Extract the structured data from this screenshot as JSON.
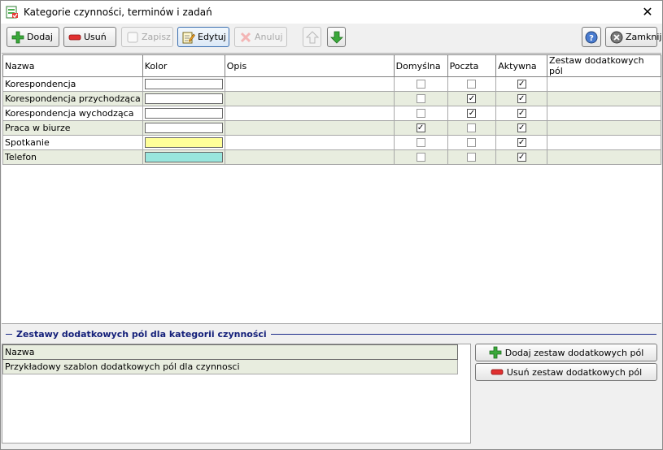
{
  "window": {
    "title": "Kategorie czynności, terminów i zadań"
  },
  "toolbar": {
    "add_label": "Dodaj",
    "remove_label": "Usuń",
    "save_label": "Zapisz",
    "edit_label": "Edytuj",
    "cancel_label": "Anuluj",
    "close_label": "Zamknij"
  },
  "grid": {
    "columns": [
      "Nazwa",
      "Kolor",
      "Opis",
      "Domyślna",
      "Poczta",
      "Aktywna",
      "Zestaw dodatkowych pól"
    ],
    "rows": [
      {
        "name": "Korespondencja",
        "color": "#ffffff",
        "description": "",
        "default": false,
        "mail": false,
        "active": true,
        "field_set": ""
      },
      {
        "name": "Korespondencja przychodząca",
        "color": "#ffffff",
        "description": "",
        "default": false,
        "mail": true,
        "active": true,
        "field_set": ""
      },
      {
        "name": "Korespondencja wychodząca",
        "color": "#ffffff",
        "description": "",
        "default": false,
        "mail": true,
        "active": true,
        "field_set": ""
      },
      {
        "name": "Praca w biurze",
        "color": "#ffffff",
        "description": "",
        "default": true,
        "mail": false,
        "active": true,
        "field_set": ""
      },
      {
        "name": "Spotkanie",
        "color": "#ffff99",
        "description": "",
        "default": false,
        "mail": false,
        "active": true,
        "field_set": ""
      },
      {
        "name": "Telefon",
        "color": "#99e6dd",
        "description": "",
        "default": false,
        "mail": false,
        "active": true,
        "field_set": ""
      }
    ]
  },
  "field_sets": {
    "section_title": "Zestawy dodatkowych pól dla kategorii czynności",
    "column": "Nazwa",
    "rows": [
      "Przykładowy szablon dodatkowych pól dla czynnosci"
    ],
    "add_button": "Dodaj zestaw dodatkowych pól",
    "remove_button": "Usuń zestaw dodatkowych pól"
  },
  "colors": {
    "row_alt": "#e8eddf",
    "section_accent": "#14207a"
  }
}
